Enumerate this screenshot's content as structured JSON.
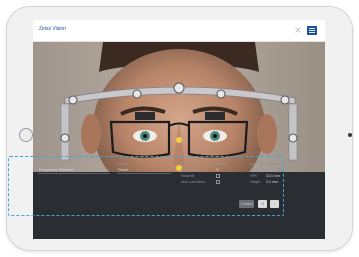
{
  "app": {
    "title": "Zeiss Vision",
    "close_icon": "close-icon",
    "menu_icon": "menu-icon"
  },
  "measurement": {
    "lens_type_label": "Lens Type",
    "lens_type_value": "Progressive Standard",
    "frame_label": "Frame",
    "frame_value": "Plastic",
    "head_posture_label": "Head posture compensation",
    "head_rotation_label": "Head rotation",
    "head_rotation_value": "0°",
    "head_tilt_label": "Head tilt",
    "auto_correction_label": "Auto correction",
    "manual_adjustment_label": "Manual adjustment",
    "pd_label": "PD/2 Corne",
    "hpv_label": "HPV",
    "hpv_value": "33.0 mm",
    "height_label": "Height",
    "height_value": "0.0 mm",
    "confirm_label": "Confirm"
  },
  "colors": {
    "accent": "#3fa6dc",
    "panel": "#2a2d32",
    "title": "#1d4fa0"
  }
}
